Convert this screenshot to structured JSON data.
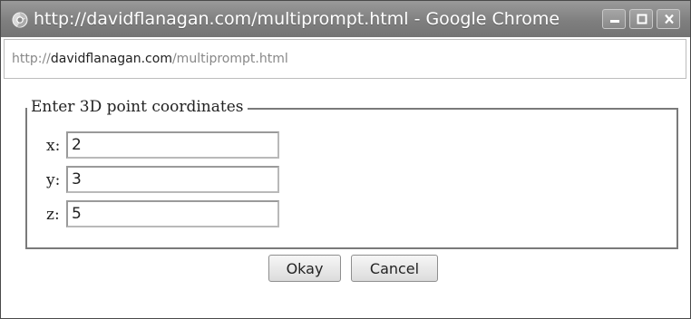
{
  "window": {
    "title": "http://davidflanagan.com/multiprompt.html - Google Chrome"
  },
  "address_bar": {
    "scheme": "http://",
    "host": "davidflanagan.com",
    "path": "/multiprompt.html"
  },
  "form": {
    "legend": "Enter 3D point coordinates",
    "fields": [
      {
        "label": "x:",
        "value": "2"
      },
      {
        "label": "y:",
        "value": "3"
      },
      {
        "label": "z:",
        "value": "5"
      }
    ],
    "okay_label": "Okay",
    "cancel_label": "Cancel"
  },
  "icons": {
    "app": "chrome-icon",
    "minimize": "minimize-icon",
    "maximize": "maximize-icon",
    "close": "close-icon"
  },
  "colors": {
    "titlebar": "#858585",
    "window_border": "#4a4a4a",
    "fieldset_border": "#7a7a7a"
  }
}
